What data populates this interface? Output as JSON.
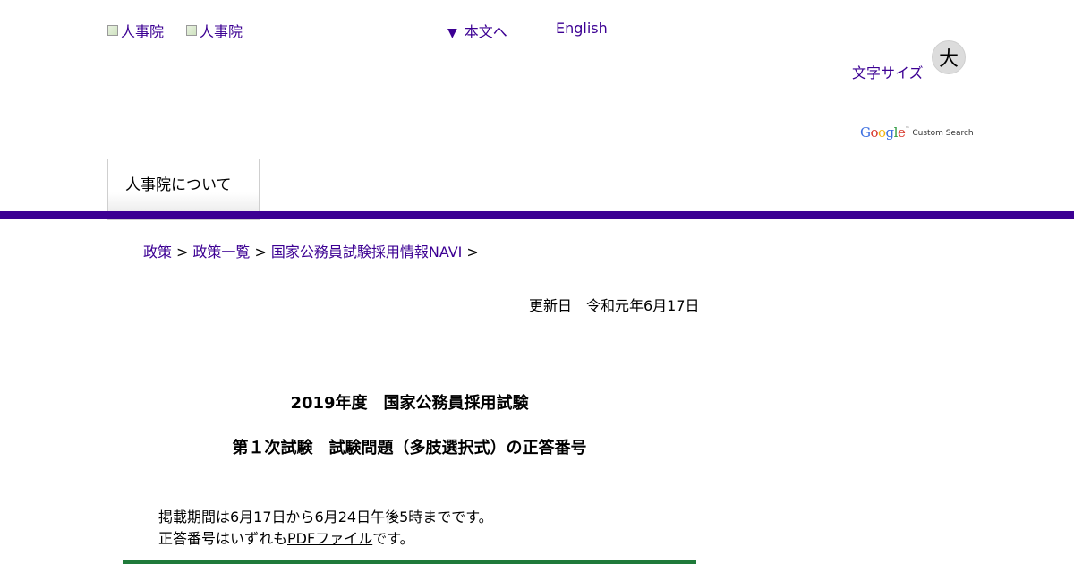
{
  "header": {
    "logo1_alt": "人事院",
    "logo2_alt": "人事院",
    "skip_link": "本文へ",
    "english_link": "English",
    "font_size_label": "文字サイズ",
    "font_size_large": "大",
    "search_brand": "Google",
    "search_brand_tm": "™",
    "search_label": "Custom Search"
  },
  "nav": {
    "tabs": [
      {
        "label": "人事院について"
      }
    ],
    "accent_color": "#3c0093"
  },
  "breadcrumb": {
    "items": [
      "政策",
      "政策一覧",
      "国家公務員試験採用情報NAVI"
    ],
    "separator": ">"
  },
  "main": {
    "updated": "更新日　令和元年6月17日",
    "title_line1": "2019年度　国家公務員採用試験",
    "title_line2": "第１次試験　試験問題（多肢選択式）の正答番号",
    "notice_line1": "掲載期間は6月17日から6月24日午後5時までです。",
    "notice_line2_prefix": "正答番号はいずれも",
    "notice_line2_link": "PDFファイル",
    "notice_line2_suffix": "です。"
  }
}
